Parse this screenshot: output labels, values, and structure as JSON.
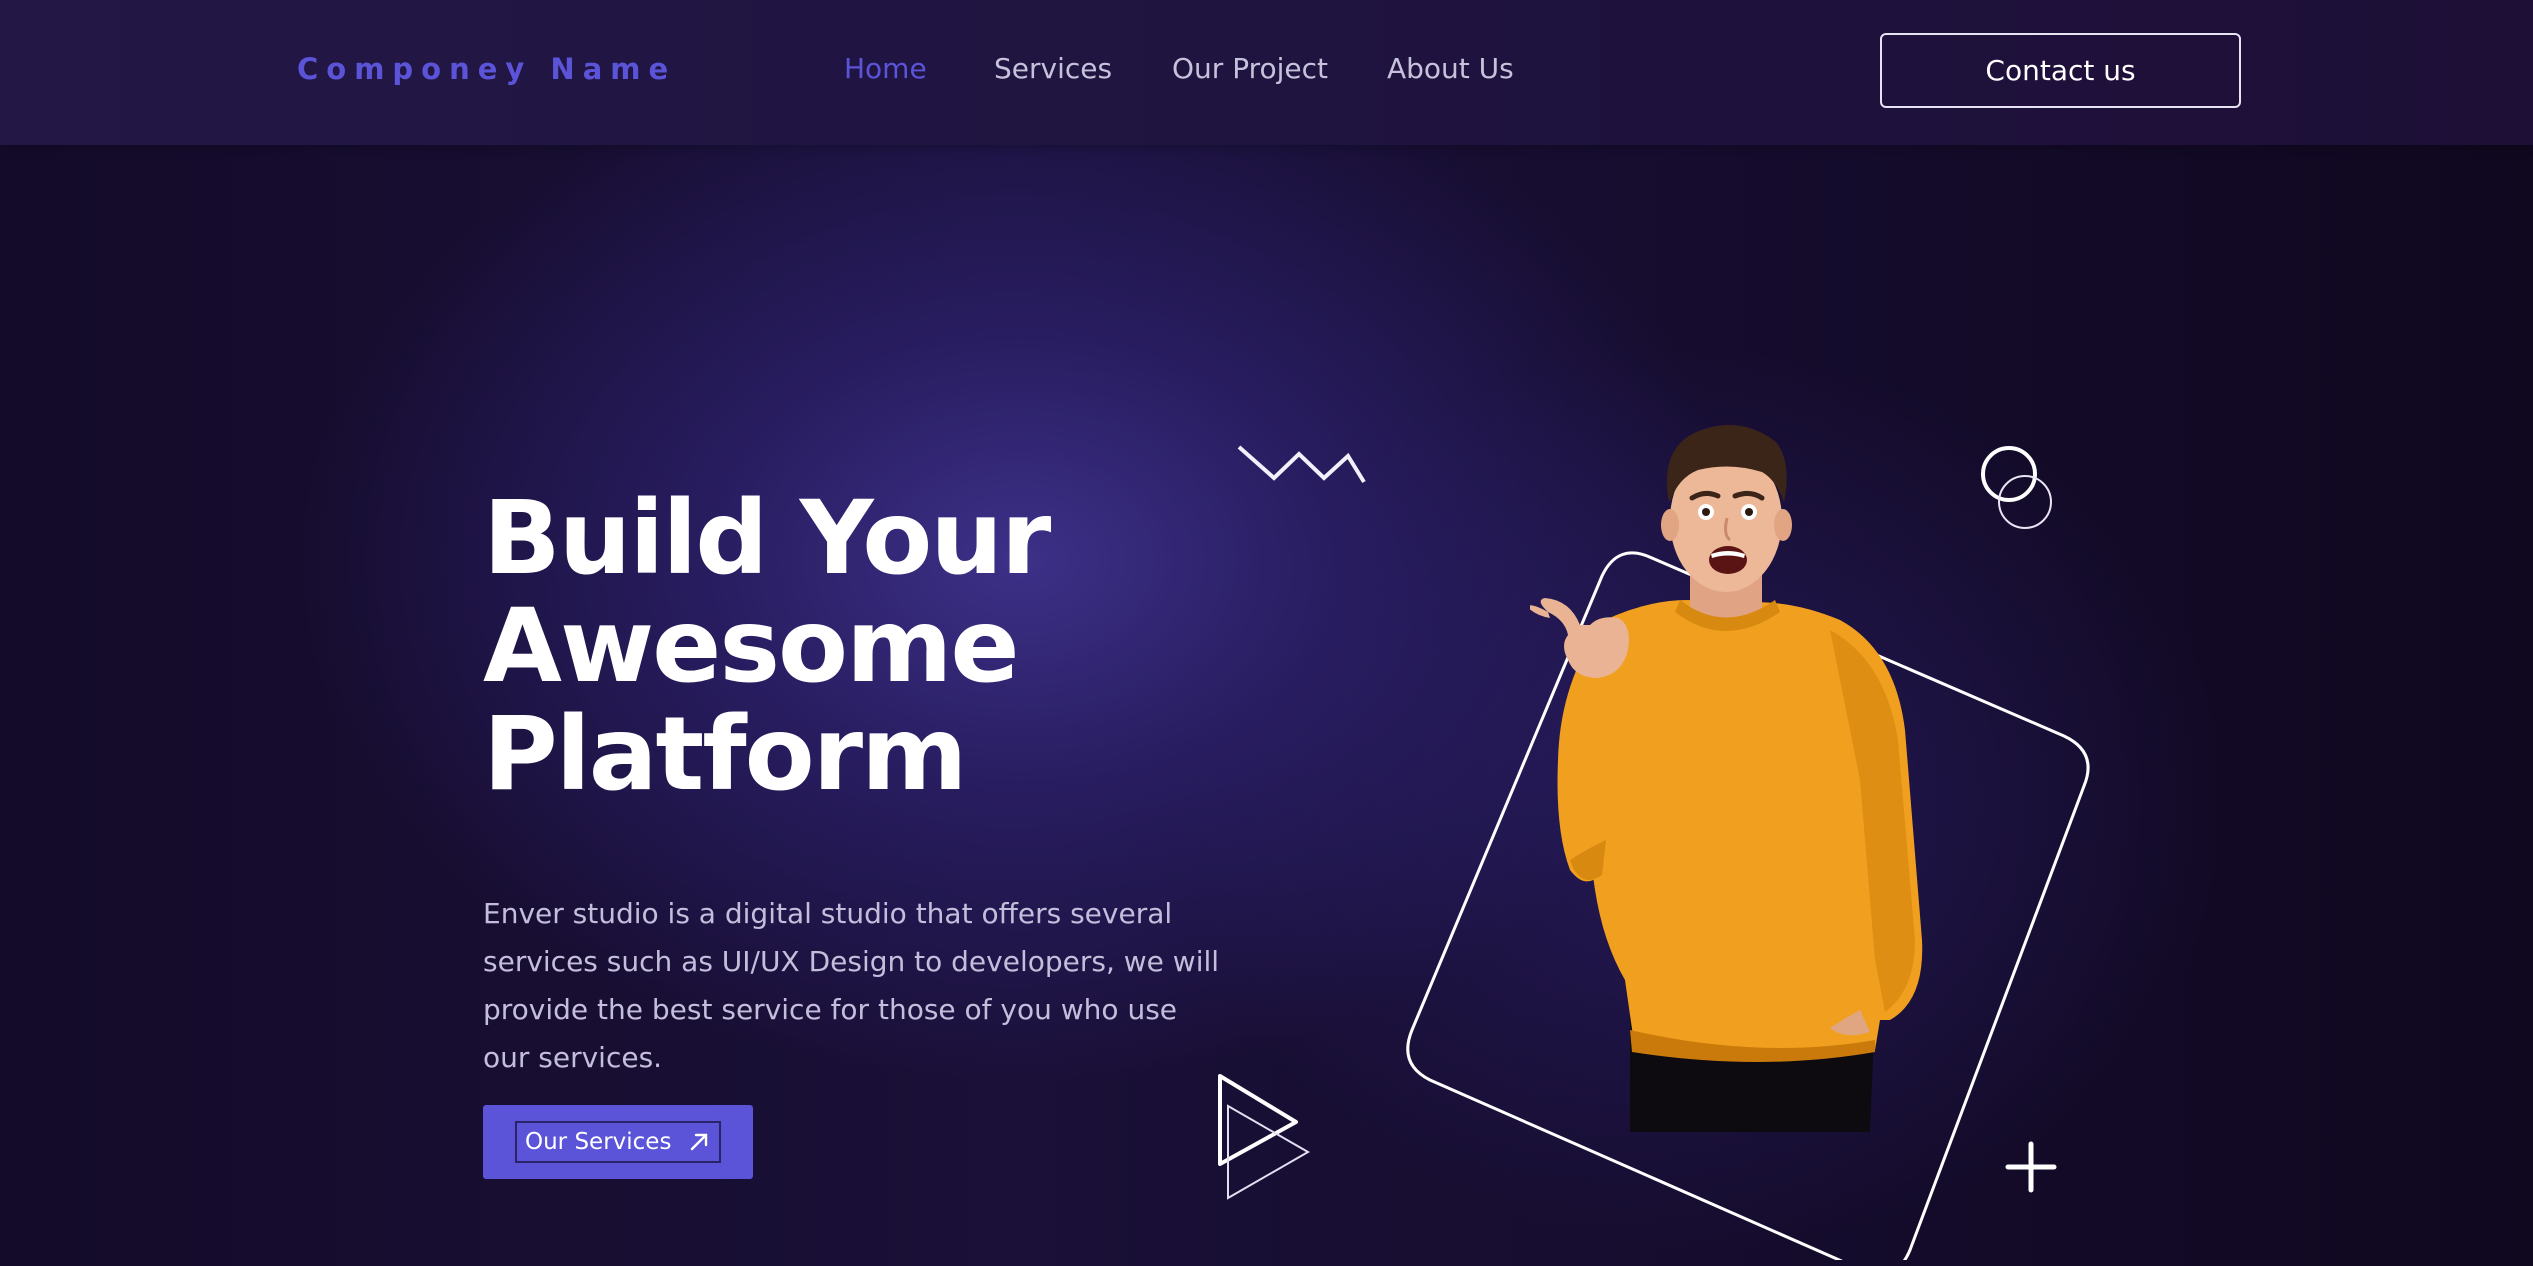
{
  "header": {
    "logo": "Componey Name",
    "nav": [
      {
        "label": "Home",
        "active": true
      },
      {
        "label": "Services",
        "active": false
      },
      {
        "label": "Our Project",
        "active": false
      },
      {
        "label": "About Us",
        "active": false
      }
    ],
    "contact_label": "Contact us"
  },
  "hero": {
    "title_lines": [
      "Build Your",
      "Awesome",
      "Platform"
    ],
    "description": "Enver studio is a digital studio that offers several services such as UI/UX Design to developers, we will provide the best service for those of you who use our services.",
    "cta_label": "Our Services"
  },
  "colors": {
    "accent": "#5b54d8",
    "sweater": "#f0a01e",
    "text_muted": "#c3bedb"
  },
  "icons": [
    "arrow-up-right-icon",
    "zigzag-icon",
    "circles-icon",
    "play-triangle-icon",
    "plus-icon"
  ]
}
